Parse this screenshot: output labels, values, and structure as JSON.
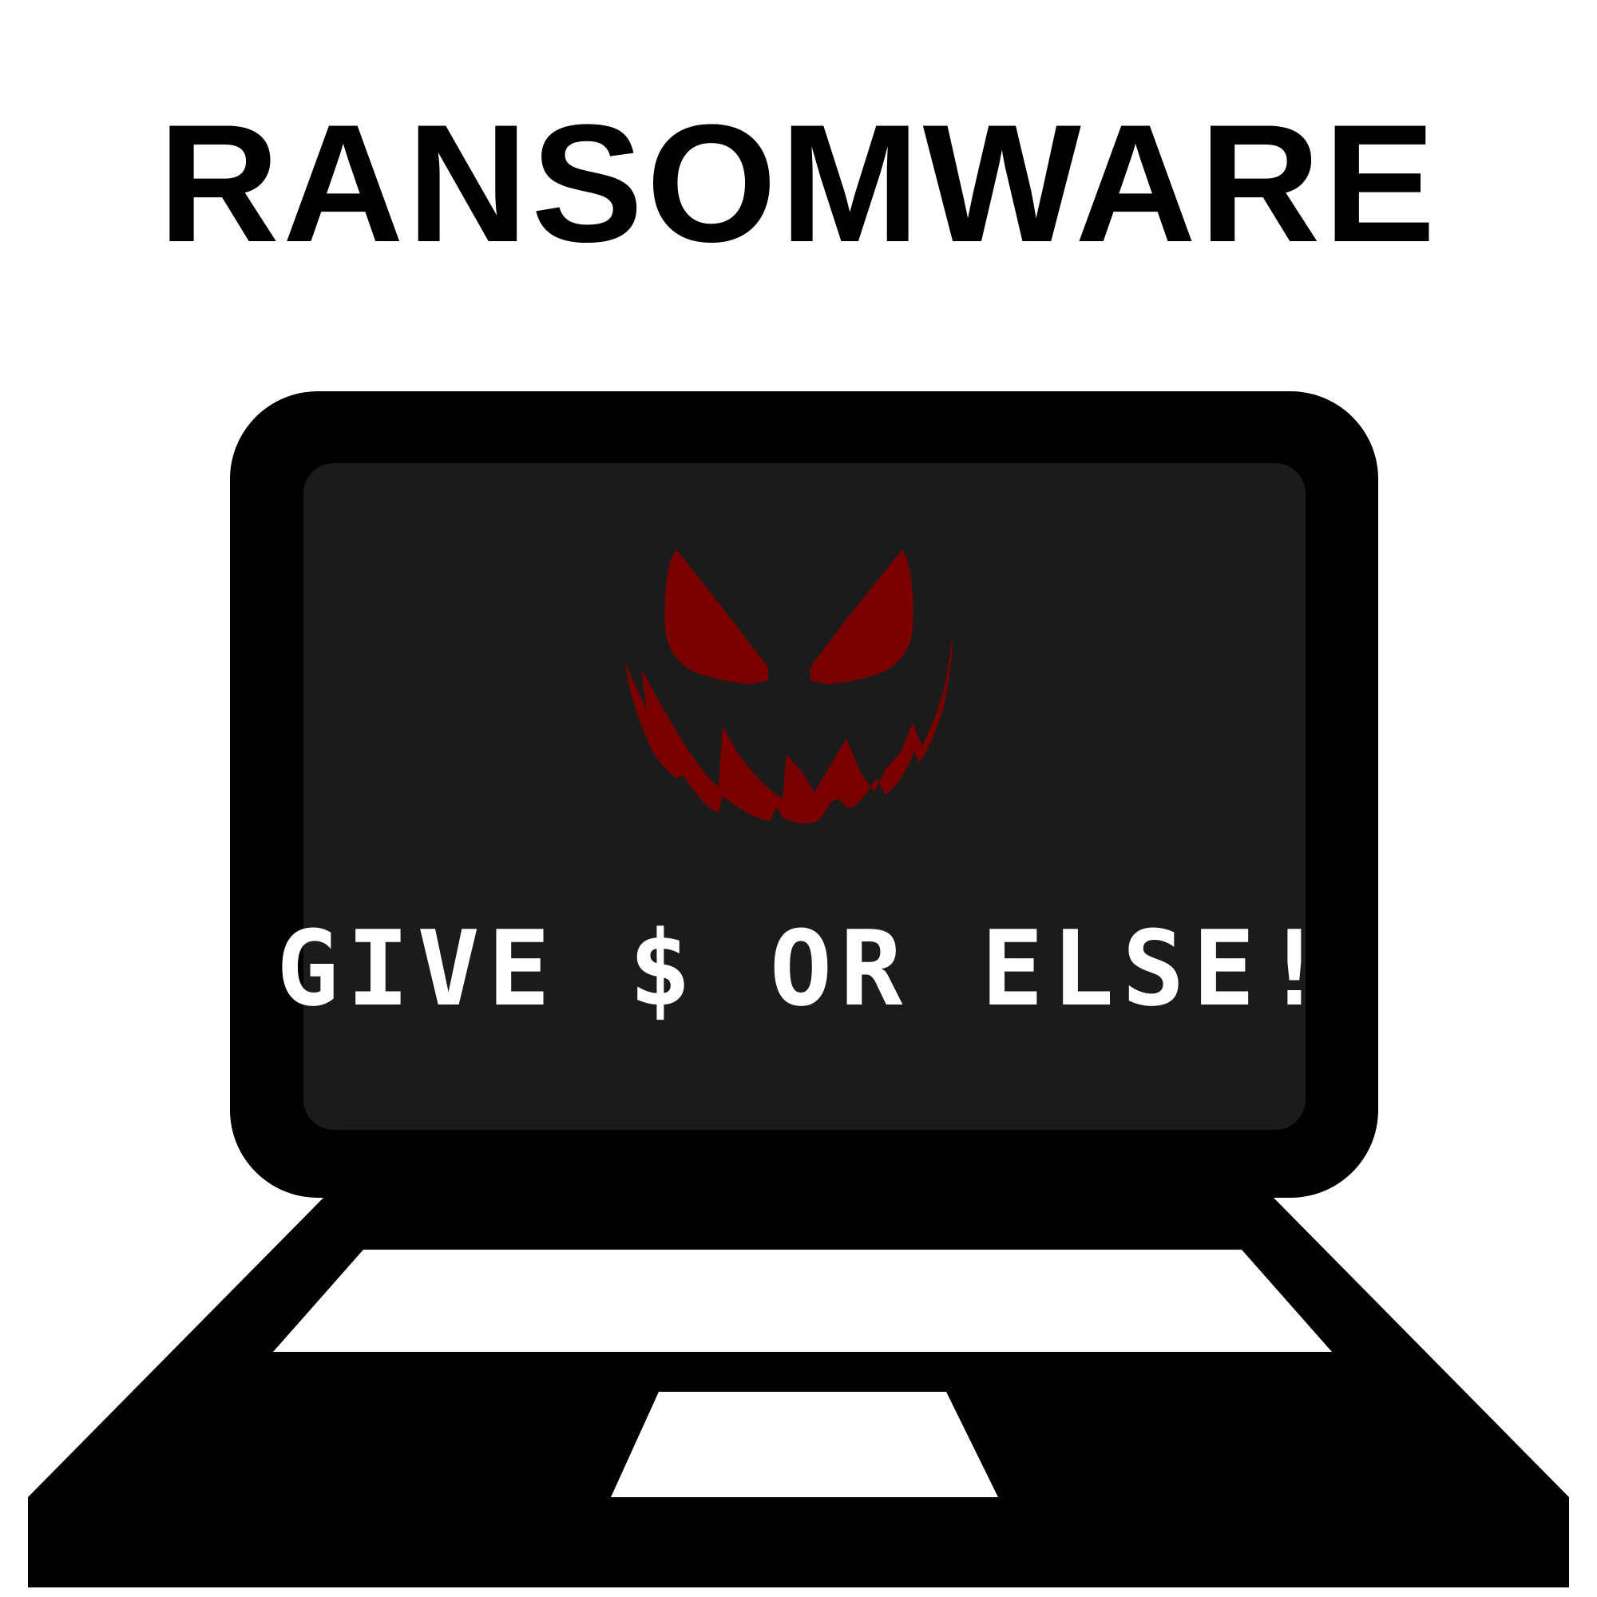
{
  "poster": {
    "title": "RANSOMWARE",
    "screen_message": "GIVE $ OR ELSE!"
  },
  "colors": {
    "laptop": "#000000",
    "screen": "#1b1b1b",
    "face": "#7a0000",
    "message": "#ffffff",
    "background": "#ffffff"
  },
  "icons": {
    "main": "laptop-icon",
    "face": "evil-grin-face-icon"
  }
}
